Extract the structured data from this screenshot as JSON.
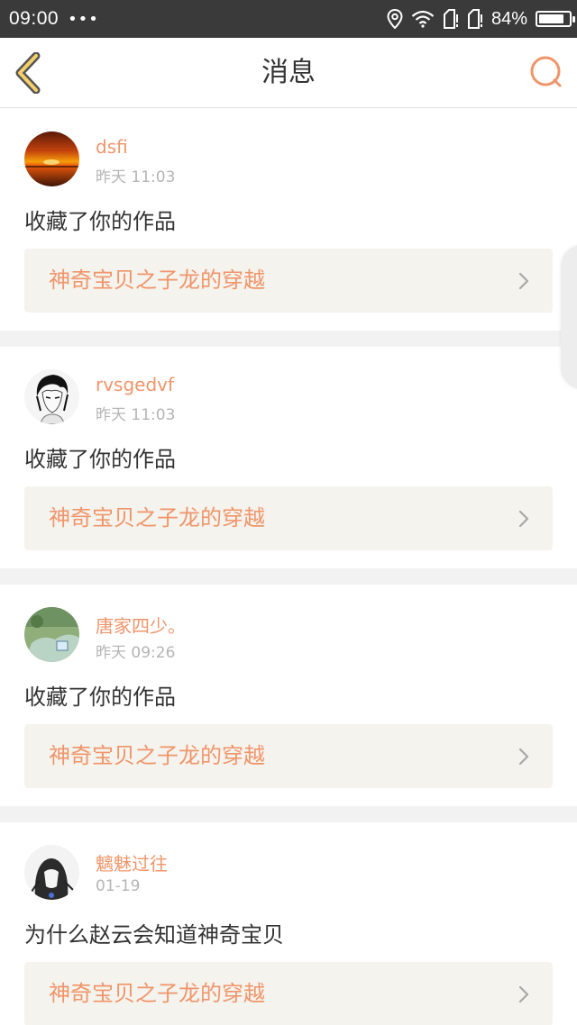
{
  "status_bar": {
    "time": "09:00",
    "dots": "•••",
    "battery_percent_text": "84%",
    "battery_level": 0.84,
    "icons": [
      "location-icon",
      "wifi-icon",
      "sim1-icon",
      "sim2-icon",
      "battery-icon"
    ]
  },
  "header": {
    "title": "消息",
    "back_icon": "chevron-left-icon",
    "search_icon": "search-icon",
    "accent_color": "#f0956a"
  },
  "messages": [
    {
      "username": "dsfi",
      "time": "昨天 11:03",
      "text": "收藏了你的作品",
      "work_title": "神奇宝贝之子龙的穿越",
      "avatar": "sunset-avatar"
    },
    {
      "username": "rvsgedvf",
      "time": "昨天 11:03",
      "text": "收藏了你的作品",
      "work_title": "神奇宝贝之子龙的穿越",
      "avatar": "anime-character-avatar"
    },
    {
      "username": "唐家四少。",
      "time": "昨天 09:26",
      "text": "收藏了你的作品",
      "work_title": "神奇宝贝之子龙的穿越",
      "avatar": "landscape-avatar"
    },
    {
      "username": "魑魅过往",
      "time": "01-19",
      "text": "为什么赵云会知道神奇宝贝",
      "work_title": "神奇宝贝之子龙的穿越",
      "avatar": "sketch-avatar"
    }
  ]
}
